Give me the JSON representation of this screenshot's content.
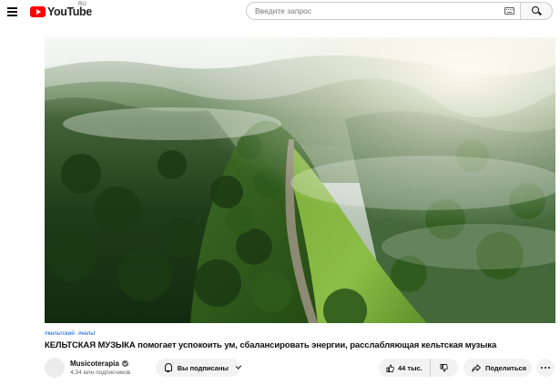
{
  "header": {
    "menu_icon": "hamburger-menu-icon",
    "logo_text": "YouTube",
    "logo_region": "RU",
    "search_placeholder": "Введите запрос",
    "keyboard_icon": "keyboard-icon",
    "search_icon": "search-icon"
  },
  "video": {
    "thumbnail_description_icon": "video-player",
    "scene": "aerial-forest-ridge-mist"
  },
  "info": {
    "hashtags": [
      "#кельтский",
      "#кельт"
    ],
    "title": "КЕЛЬТСКАЯ МУЗЫКА помогает успокоить ум, сбалансировать энергии, расслабляющая кельтская музыка"
  },
  "owner": {
    "channel_name": "Musicoterapia",
    "verified": true,
    "subscribers": "4,34 млн подписчиков",
    "subscribe_label": "Вы подписаны"
  },
  "actions": {
    "like_count": "44 тыс.",
    "share_label": "Поделиться"
  },
  "colors": {
    "brand_red": "#ff0000",
    "link_blue": "#065fd4",
    "chip_bg": "#f2f2f2"
  }
}
